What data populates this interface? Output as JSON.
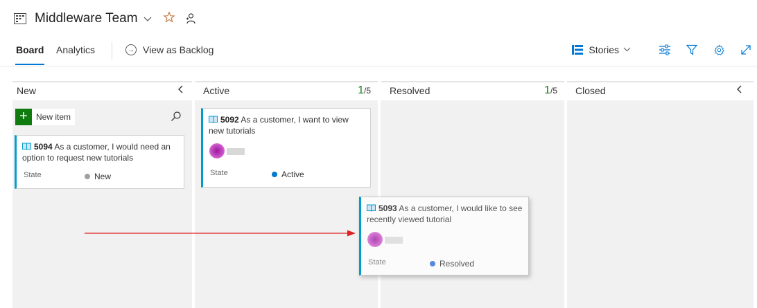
{
  "header": {
    "team_title": "Middleware Team",
    "icons": {
      "board": "board-icon",
      "dropdown": "chevron-down-icon",
      "favorite": "star-icon",
      "members": "team-members-icon"
    }
  },
  "tabs": {
    "board": "Board",
    "analytics": "Analytics",
    "view_backlog": "View as Backlog"
  },
  "toolbar": {
    "backlog_level": "Stories",
    "icons": [
      "settings-sliders-icon",
      "filter-icon",
      "gear-icon",
      "fullscreen-icon"
    ]
  },
  "columns": [
    {
      "name": "New",
      "collapse": "‹"
    },
    {
      "name": "Active",
      "count": "1",
      "limit": "/5"
    },
    {
      "name": "Resolved",
      "count": "1",
      "limit": "/5"
    },
    {
      "name": "Closed",
      "collapse": "‹"
    }
  ],
  "new_item_label": "New item",
  "cards": [
    {
      "id": "5094",
      "title": "As a customer, I would need an option to request new tutorials",
      "state_label": "State",
      "state": "New",
      "state_color": "#a0a0a0"
    },
    {
      "id": "5092",
      "title": "As a customer, I want to view new tutorials",
      "state_label": "State",
      "state": "Active",
      "state_color": "#007acc"
    },
    {
      "id": "5093",
      "title": "As a customer, I would like to see recently viewed tutorial",
      "state_label": "State",
      "state": "Resolved",
      "state_color": "#5688e0"
    }
  ],
  "colors": {
    "accent": "#0078d4",
    "new_button": "#107c10",
    "card_stripe": "#009ccc",
    "arrow": "#e02020"
  }
}
